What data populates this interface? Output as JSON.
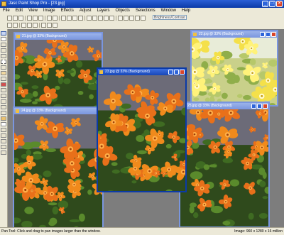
{
  "app": {
    "title": "Jasc Paint Shop Pro - [23.jpg]",
    "colors": {
      "titlebar": "#0b3aa8",
      "panel": "#ece9d8",
      "workspace": "#7d7d7d"
    }
  },
  "menu": {
    "items": [
      "File",
      "Edit",
      "View",
      "Image",
      "Effects",
      "Adjust",
      "Layers",
      "Objects",
      "Selections",
      "Window",
      "Help"
    ]
  },
  "toolbar": {
    "presets_label": "Brightness/Contrast"
  },
  "windows": [
    {
      "title": "21.jpg @ 33% (Background)",
      "active": false,
      "theme": "orange"
    },
    {
      "title": "22.jpg @ 33% (Background)",
      "active": false,
      "theme": "yellow"
    },
    {
      "title": "24.jpg @ 33% (Background)",
      "active": false,
      "theme": "orange"
    },
    {
      "title": "25.jpg @ 33% (Background)",
      "active": false,
      "theme": "orange"
    },
    {
      "title": "23.jpg @ 33% (Background)",
      "active": true,
      "theme": "orange"
    }
  ],
  "status": {
    "help": "Pan Tool: Click and drag to pan images larger than the window.",
    "info": "Image: 960 x 1280 x 16 million"
  }
}
